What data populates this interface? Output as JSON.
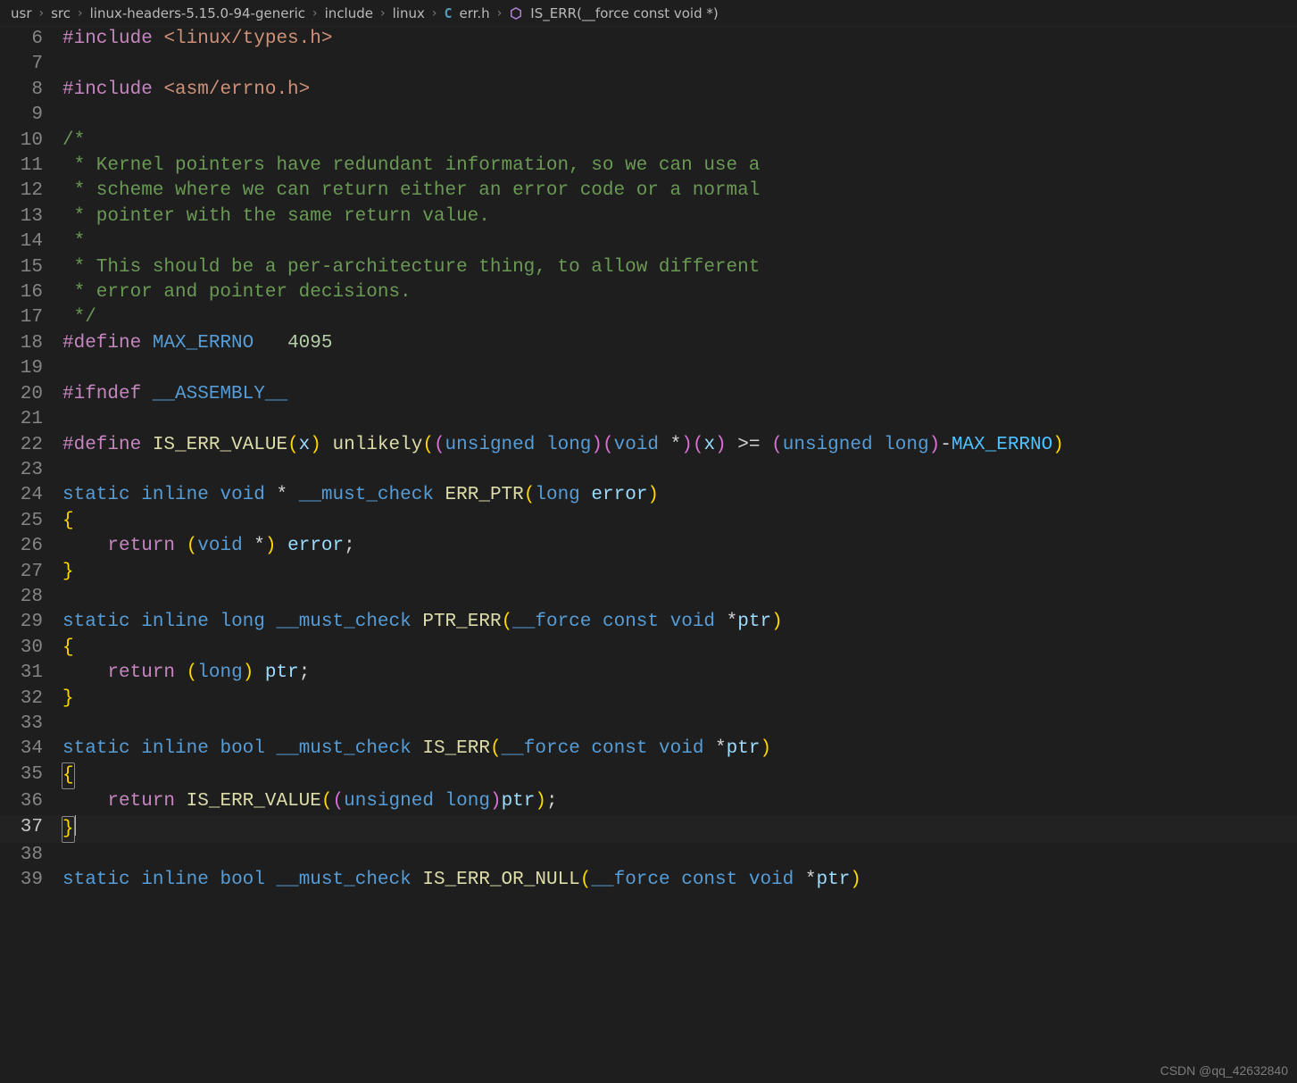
{
  "breadcrumb": {
    "parts": [
      "usr",
      "src",
      "linux-headers-5.15.0-94-generic",
      "include",
      "linux"
    ],
    "file_icon_letter": "C",
    "file": "err.h",
    "symbol": "IS_ERR(__force const void *)"
  },
  "editor": {
    "first_line_number": 6,
    "active_line_number": 37
  },
  "code_lines": [
    {
      "n": 6,
      "tokens": [
        [
          "pp",
          "#include"
        ],
        [
          "pun",
          " "
        ],
        [
          "str",
          "<linux/types.h>"
        ]
      ]
    },
    {
      "n": 7,
      "tokens": []
    },
    {
      "n": 8,
      "tokens": [
        [
          "pp",
          "#include"
        ],
        [
          "pun",
          " "
        ],
        [
          "str",
          "<asm/errno.h>"
        ]
      ]
    },
    {
      "n": 9,
      "tokens": []
    },
    {
      "n": 10,
      "tokens": [
        [
          "com",
          "/*"
        ]
      ]
    },
    {
      "n": 11,
      "tokens": [
        [
          "com",
          " * Kernel pointers have redundant information, so we can use a"
        ]
      ]
    },
    {
      "n": 12,
      "tokens": [
        [
          "com",
          " * scheme where we can return either an error code or a normal"
        ]
      ]
    },
    {
      "n": 13,
      "tokens": [
        [
          "com",
          " * pointer with the same return value."
        ]
      ]
    },
    {
      "n": 14,
      "tokens": [
        [
          "com",
          " *"
        ]
      ]
    },
    {
      "n": 15,
      "tokens": [
        [
          "com",
          " * This should be a per-architecture thing, to allow different"
        ]
      ]
    },
    {
      "n": 16,
      "tokens": [
        [
          "com",
          " * error and pointer decisions."
        ]
      ]
    },
    {
      "n": 17,
      "tokens": [
        [
          "com",
          " */"
        ]
      ]
    },
    {
      "n": 18,
      "tokens": [
        [
          "pp",
          "#define"
        ],
        [
          "pun",
          " "
        ],
        [
          "mac",
          "MAX_ERRNO"
        ],
        [
          "pun",
          "   "
        ],
        [
          "num",
          "4095"
        ]
      ]
    },
    {
      "n": 19,
      "tokens": []
    },
    {
      "n": 20,
      "tokens": [
        [
          "pp",
          "#ifndef"
        ],
        [
          "pun",
          " "
        ],
        [
          "mac",
          "__ASSEMBLY__"
        ]
      ]
    },
    {
      "n": 21,
      "tokens": []
    },
    {
      "n": 22,
      "tokens": [
        [
          "pp",
          "#define"
        ],
        [
          "pun",
          " "
        ],
        [
          "fn",
          "IS_ERR_VALUE"
        ],
        [
          "ybr",
          "("
        ],
        [
          "id",
          "x"
        ],
        [
          "ybr",
          ")"
        ],
        [
          "pun",
          " "
        ],
        [
          "fn",
          "unlikely"
        ],
        [
          "ybr",
          "("
        ],
        [
          "pbr",
          "("
        ],
        [
          "kw",
          "unsigned"
        ],
        [
          "pun",
          " "
        ],
        [
          "kw",
          "long"
        ],
        [
          "pbr",
          ")"
        ],
        [
          "pbr",
          "("
        ],
        [
          "kw",
          "void"
        ],
        [
          "pun",
          " *"
        ],
        [
          "pbr",
          ")"
        ],
        [
          "pbr",
          "("
        ],
        [
          "id",
          "x"
        ],
        [
          "pbr",
          ")"
        ],
        [
          "pun",
          " >= "
        ],
        [
          "pbr",
          "("
        ],
        [
          "kw",
          "unsigned"
        ],
        [
          "pun",
          " "
        ],
        [
          "kw",
          "long"
        ],
        [
          "pbr",
          ")"
        ],
        [
          "pun",
          "-"
        ],
        [
          "macu",
          "MAX_ERRNO"
        ],
        [
          "ybr",
          ")"
        ]
      ]
    },
    {
      "n": 23,
      "tokens": []
    },
    {
      "n": 24,
      "tokens": [
        [
          "kw",
          "static"
        ],
        [
          "pun",
          " "
        ],
        [
          "kw",
          "inline"
        ],
        [
          "pun",
          " "
        ],
        [
          "kw",
          "void"
        ],
        [
          "pun",
          " * "
        ],
        [
          "mac",
          "__must_check"
        ],
        [
          "pun",
          " "
        ],
        [
          "fn",
          "ERR_PTR"
        ],
        [
          "ybr",
          "("
        ],
        [
          "kw",
          "long"
        ],
        [
          "pun",
          " "
        ],
        [
          "id",
          "error"
        ],
        [
          "ybr",
          ")"
        ]
      ]
    },
    {
      "n": 25,
      "tokens": [
        [
          "ybr",
          "{"
        ]
      ]
    },
    {
      "n": 26,
      "tokens": [
        [
          "pun",
          "    "
        ],
        [
          "pp",
          "return"
        ],
        [
          "pun",
          " "
        ],
        [
          "ybr",
          "("
        ],
        [
          "kw",
          "void"
        ],
        [
          "pun",
          " *"
        ],
        [
          "ybr",
          ")"
        ],
        [
          "pun",
          " "
        ],
        [
          "id",
          "error"
        ],
        [
          "pun",
          ";"
        ]
      ]
    },
    {
      "n": 27,
      "tokens": [
        [
          "ybr",
          "}"
        ]
      ]
    },
    {
      "n": 28,
      "tokens": []
    },
    {
      "n": 29,
      "tokens": [
        [
          "kw",
          "static"
        ],
        [
          "pun",
          " "
        ],
        [
          "kw",
          "inline"
        ],
        [
          "pun",
          " "
        ],
        [
          "kw",
          "long"
        ],
        [
          "pun",
          " "
        ],
        [
          "mac",
          "__must_check"
        ],
        [
          "pun",
          " "
        ],
        [
          "fn",
          "PTR_ERR"
        ],
        [
          "ybr",
          "("
        ],
        [
          "mac",
          "__force"
        ],
        [
          "pun",
          " "
        ],
        [
          "kw",
          "const"
        ],
        [
          "pun",
          " "
        ],
        [
          "kw",
          "void"
        ],
        [
          "pun",
          " *"
        ],
        [
          "id",
          "ptr"
        ],
        [
          "ybr",
          ")"
        ]
      ]
    },
    {
      "n": 30,
      "tokens": [
        [
          "ybr",
          "{"
        ]
      ]
    },
    {
      "n": 31,
      "tokens": [
        [
          "pun",
          "    "
        ],
        [
          "pp",
          "return"
        ],
        [
          "pun",
          " "
        ],
        [
          "ybr",
          "("
        ],
        [
          "kw",
          "long"
        ],
        [
          "ybr",
          ")"
        ],
        [
          "pun",
          " "
        ],
        [
          "id",
          "ptr"
        ],
        [
          "pun",
          ";"
        ]
      ]
    },
    {
      "n": 32,
      "tokens": [
        [
          "ybr",
          "}"
        ]
      ]
    },
    {
      "n": 33,
      "tokens": []
    },
    {
      "n": 34,
      "tokens": [
        [
          "kw",
          "static"
        ],
        [
          "pun",
          " "
        ],
        [
          "kw",
          "inline"
        ],
        [
          "pun",
          " "
        ],
        [
          "kw",
          "bool"
        ],
        [
          "pun",
          " "
        ],
        [
          "mac",
          "__must_check"
        ],
        [
          "pun",
          " "
        ],
        [
          "fn",
          "IS_ERR"
        ],
        [
          "ybr",
          "("
        ],
        [
          "mac",
          "__force"
        ],
        [
          "pun",
          " "
        ],
        [
          "kw",
          "const"
        ],
        [
          "pun",
          " "
        ],
        [
          "kw",
          "void"
        ],
        [
          "pun",
          " *"
        ],
        [
          "id",
          "ptr"
        ],
        [
          "ybr",
          ")"
        ]
      ]
    },
    {
      "n": 35,
      "tokens": [
        [
          "ybr-boxed",
          "{"
        ]
      ]
    },
    {
      "n": 36,
      "tokens": [
        [
          "pun",
          "    "
        ],
        [
          "pp",
          "return"
        ],
        [
          "pun",
          " "
        ],
        [
          "fn",
          "IS_ERR_VALUE"
        ],
        [
          "ybr",
          "("
        ],
        [
          "pbr",
          "("
        ],
        [
          "kw",
          "unsigned"
        ],
        [
          "pun",
          " "
        ],
        [
          "kw",
          "long"
        ],
        [
          "pbr",
          ")"
        ],
        [
          "id",
          "ptr"
        ],
        [
          "ybr",
          ")"
        ],
        [
          "pun",
          ";"
        ]
      ]
    },
    {
      "n": 37,
      "tokens": [
        [
          "ybr-boxed",
          "}"
        ],
        [
          "caret",
          ""
        ]
      ]
    },
    {
      "n": 38,
      "tokens": []
    },
    {
      "n": 39,
      "tokens": [
        [
          "kw",
          "static"
        ],
        [
          "pun",
          " "
        ],
        [
          "kw",
          "inline"
        ],
        [
          "pun",
          " "
        ],
        [
          "kw",
          "bool"
        ],
        [
          "pun",
          " "
        ],
        [
          "mac",
          "__must_check"
        ],
        [
          "pun",
          " "
        ],
        [
          "fn",
          "IS_ERR_OR_NULL"
        ],
        [
          "ybr",
          "("
        ],
        [
          "mac",
          "__force"
        ],
        [
          "pun",
          " "
        ],
        [
          "kw",
          "const"
        ],
        [
          "pun",
          " "
        ],
        [
          "kw",
          "void"
        ],
        [
          "pun",
          " *"
        ],
        [
          "id",
          "ptr"
        ],
        [
          "ybr",
          ")"
        ]
      ]
    }
  ],
  "watermark": "CSDN @qq_42632840"
}
